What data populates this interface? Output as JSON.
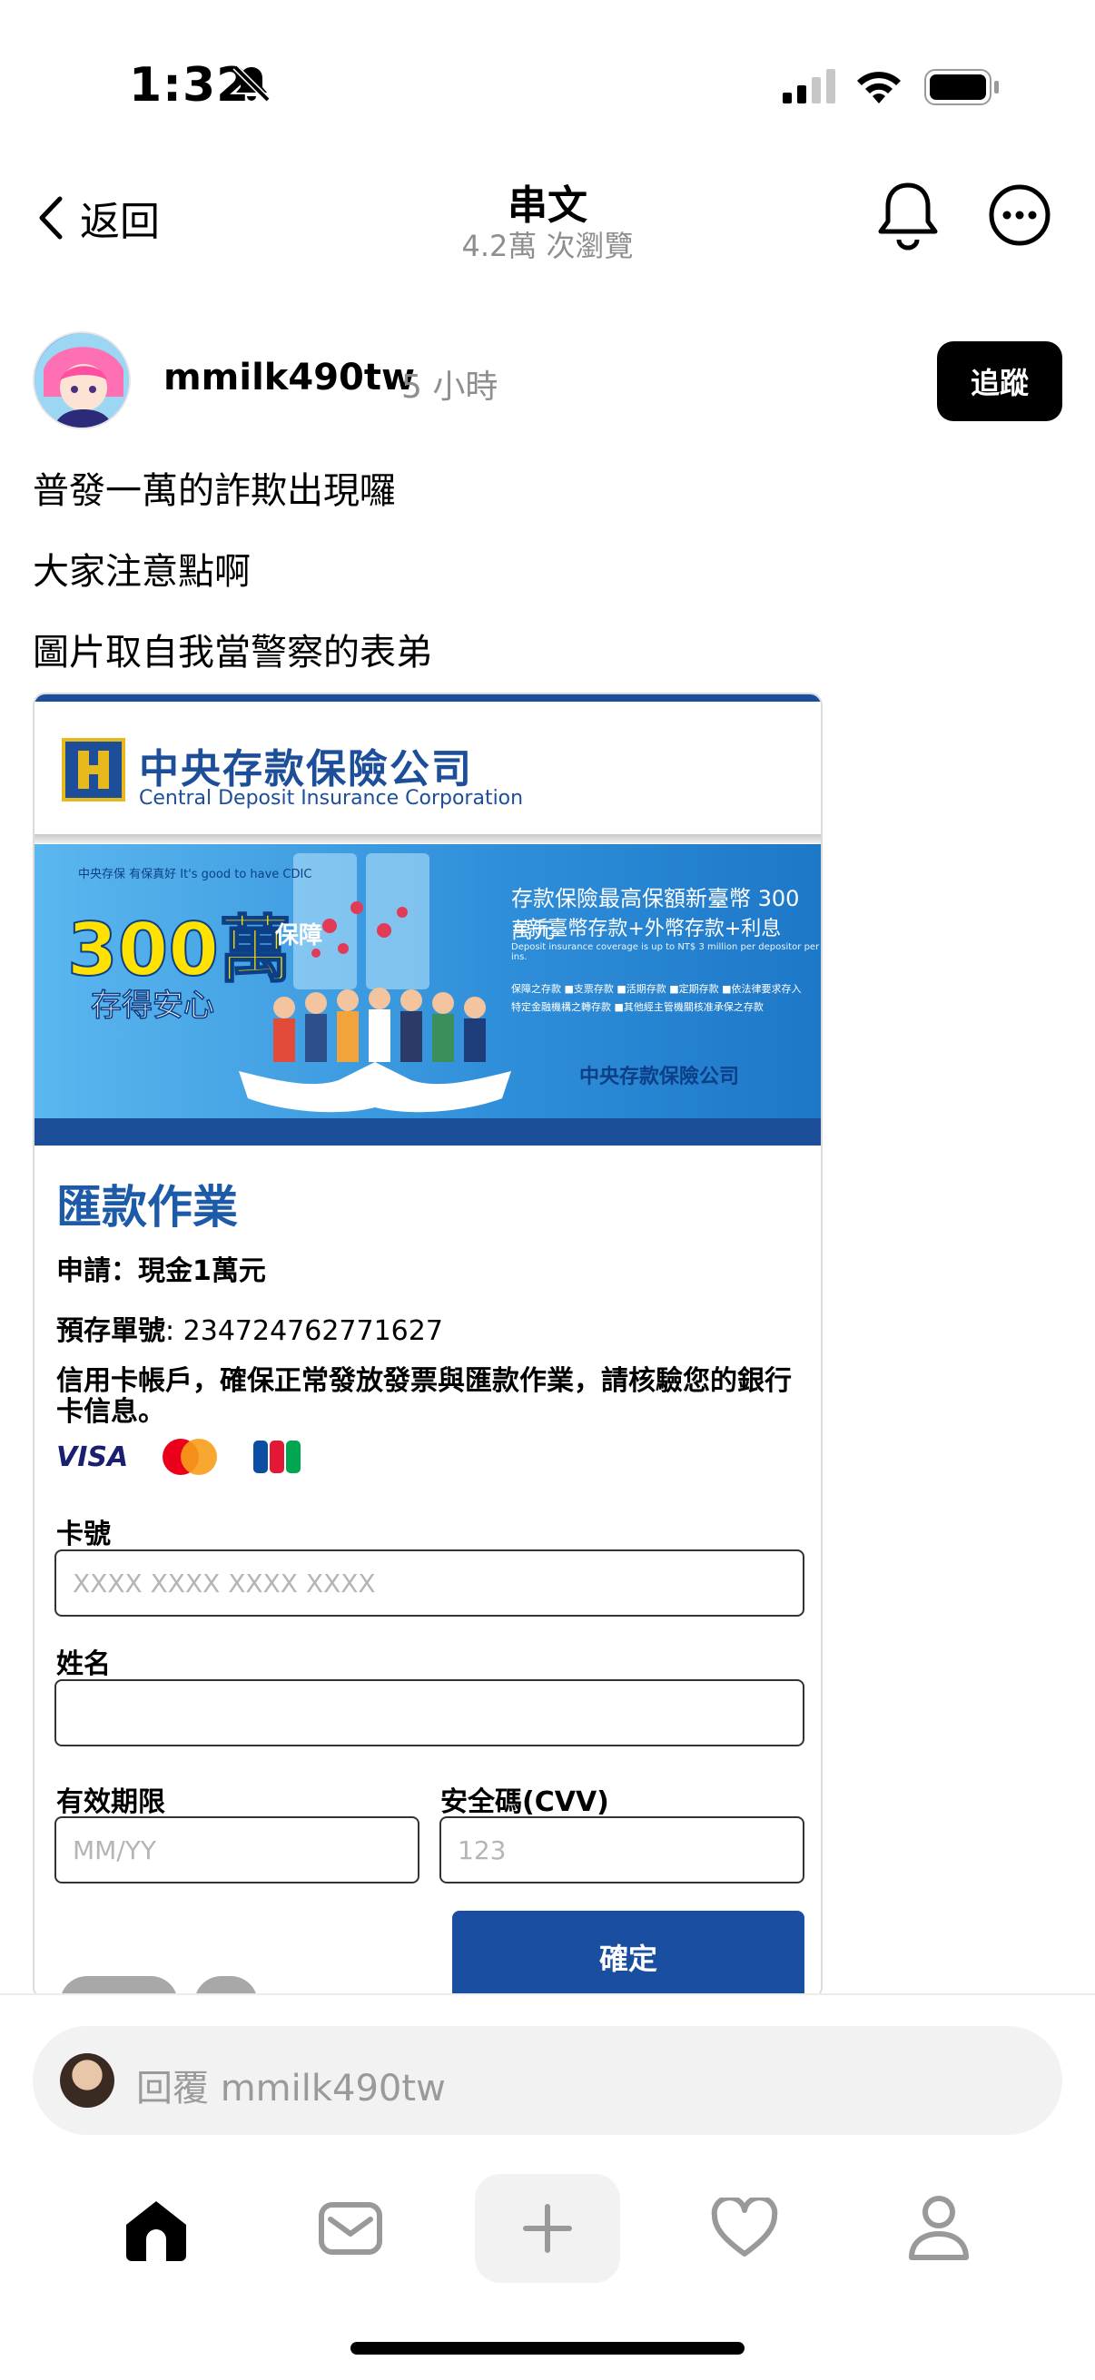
{
  "status": {
    "time": "1:32"
  },
  "nav": {
    "back_label": "返回",
    "title": "串文",
    "subtitle": "4.2萬 次瀏覽"
  },
  "post": {
    "username": "mmilk490tw",
    "time_ago": "5 小時",
    "follow_label": "追蹤",
    "lines": [
      "普發一萬的詐欺出現囉",
      "大家注意點啊",
      "圖片取自我當警察的表弟"
    ]
  },
  "image": {
    "org_zh": "中央存款保險公司",
    "org_en": "Central Deposit Insurance Corporation",
    "banner": {
      "small": "中央存保 有保真好 It's good to have CDIC",
      "amount": "300萬",
      "guarantee": "保障",
      "slogan": "存得安心",
      "right1": "存款保險最高保額新臺幣 300 萬元",
      "right2": "=新臺幣存款+外幣存款+利息",
      "right3": "Deposit insurance coverage is up to NT$ 3 million per depositor per ins.",
      "right4": "保障之存款 ■支票存款 ■活期存款 ■定期存款 ■依法律要求存入特定金融機構之轉存款 ■其他經主管機關核准承保之存款",
      "logo2": "中央存款保險公司"
    },
    "form": {
      "title": "匯款作業",
      "apply_label": "申請：",
      "apply_value": "現金1萬元",
      "deposit_label": "預存單號",
      "deposit_value": ": 234724762771627",
      "note": "信用卡帳戶，確保正常發放發票與匯款作業，請核驗您的銀行卡信息。",
      "card_brands": [
        "VISA",
        "MasterCard",
        "JCB"
      ],
      "card_number_label": "卡號",
      "card_number_placeholder": "XXXX XXXX XXXX XXXX",
      "name_label": "姓名",
      "expiry_label": "有效期限",
      "expiry_placeholder": "MM/YY",
      "cvv_label": "安全碼(CVV)",
      "cvv_placeholder": "123",
      "confirm_label": "確定"
    }
  },
  "reply": {
    "placeholder": "回覆 mmilk490tw"
  },
  "tabs": [
    "home-icon",
    "mail-icon",
    "plus-icon",
    "heart-icon",
    "profile-icon"
  ]
}
